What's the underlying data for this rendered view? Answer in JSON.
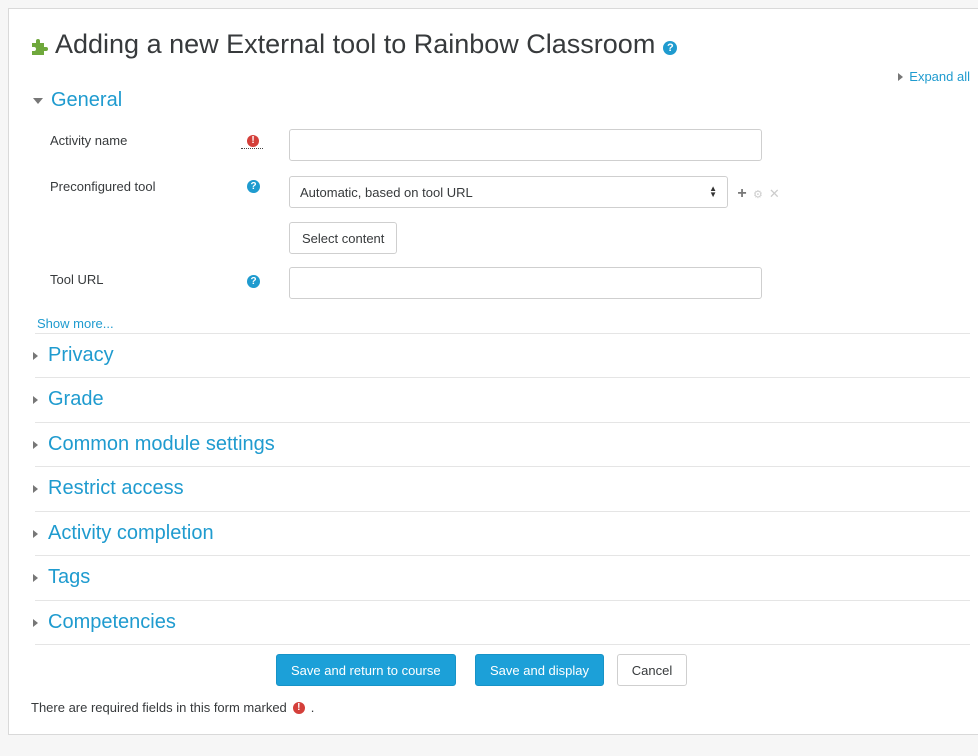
{
  "page_title": "Adding a new External tool to Rainbow Classroom",
  "expand_all": "Expand all",
  "sections": {
    "general": "General",
    "privacy": "Privacy",
    "grade": "Grade",
    "common_module_settings": "Common module settings",
    "restrict_access": "Restrict access",
    "activity_completion": "Activity completion",
    "tags": "Tags",
    "competencies": "Competencies"
  },
  "fields": {
    "activity_name": {
      "label": "Activity name",
      "value": ""
    },
    "preconfigured_tool": {
      "label": "Preconfigured tool",
      "selected": "Automatic, based on tool URL"
    },
    "select_content": "Select content",
    "tool_url": {
      "label": "Tool URL",
      "value": ""
    }
  },
  "show_more": "Show more...",
  "buttons": {
    "save_return": "Save and return to course",
    "save_display": "Save and display",
    "cancel": "Cancel"
  },
  "required_note": "There are required fields in this form marked",
  "required_note_end": ".",
  "icons": {
    "help": "?",
    "required": "!"
  },
  "colors": {
    "link": "#1f9bcf",
    "primary_button": "#1ca0d8",
    "required": "#d43f3a"
  }
}
